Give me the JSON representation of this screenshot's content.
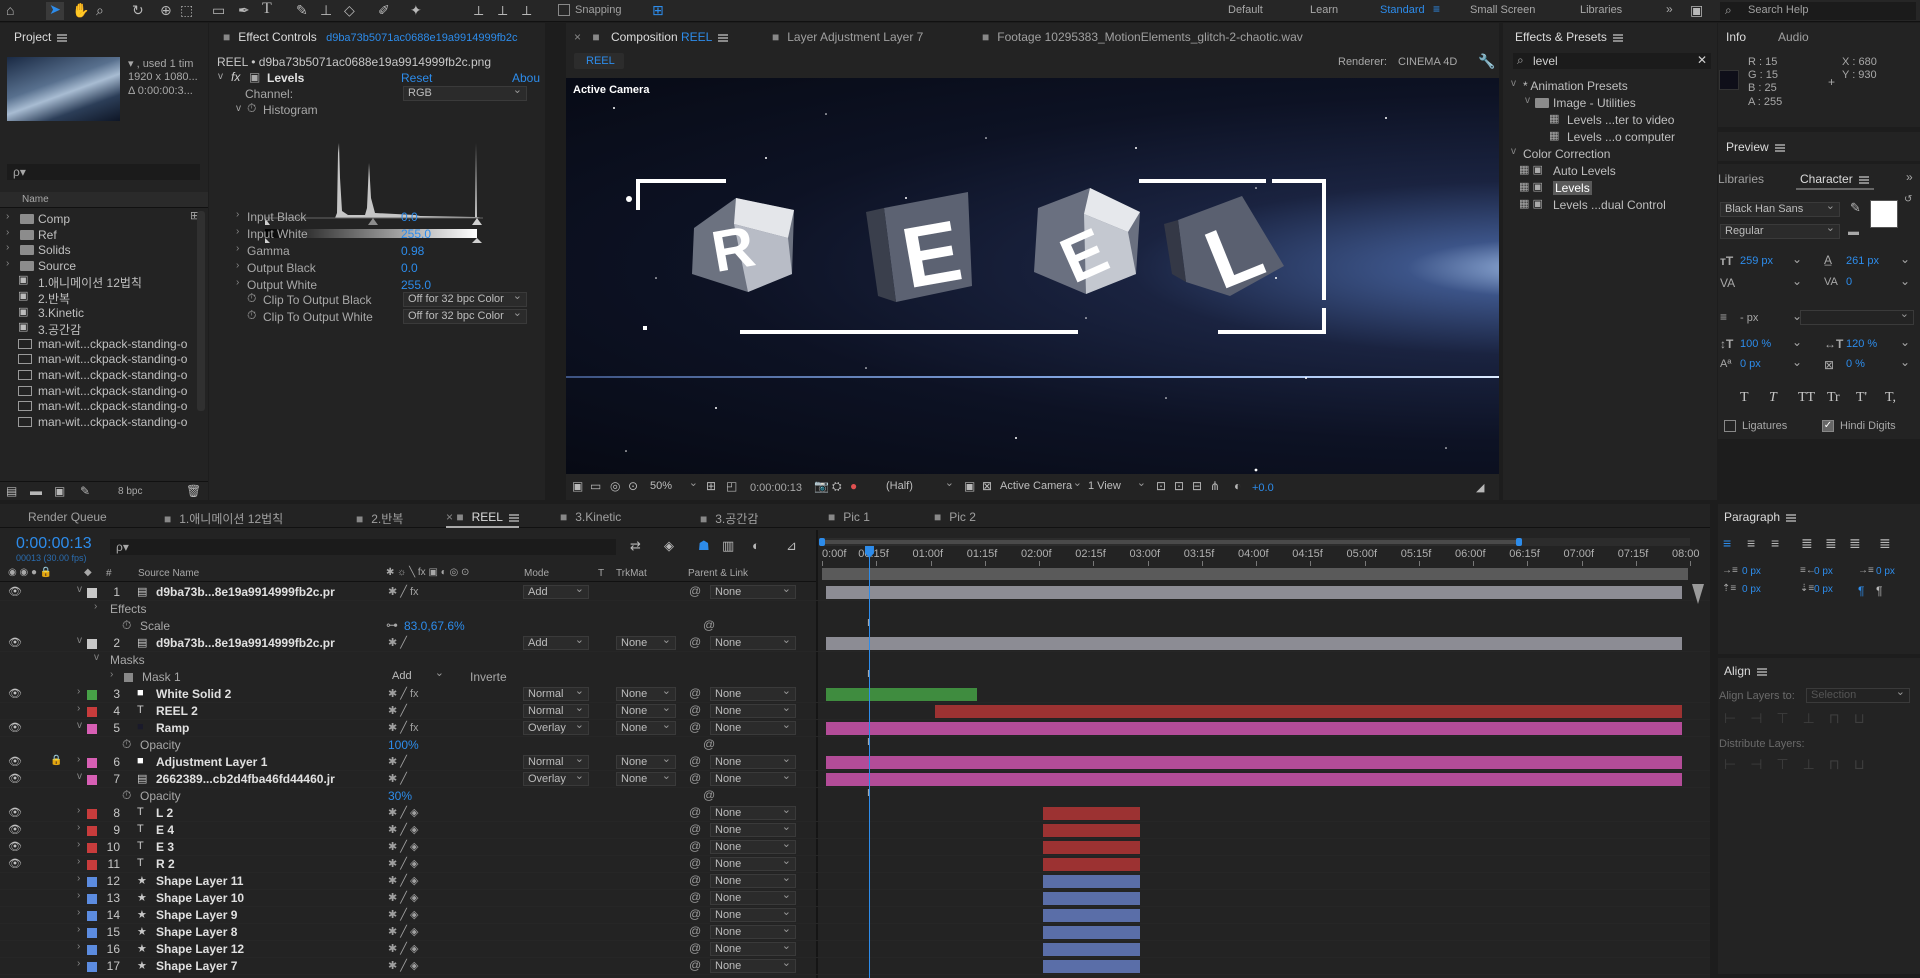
{
  "toolbar": {
    "snapping_label": "Snapping",
    "workspaces": [
      "Default",
      "Learn",
      "Standard",
      "Small Screen",
      "Libraries"
    ],
    "active_workspace": "Standard",
    "search_help": "Search Help"
  },
  "project": {
    "tab": "Project",
    "thumb_info": [
      "▾ , used 1 tim",
      "1920 x 1080...",
      "Δ 0:00:00:3..."
    ],
    "search_placeholder": "ρ▾",
    "col_name": "Name",
    "items": [
      {
        "label": "Comp",
        "type": "folder"
      },
      {
        "label": "Ref",
        "type": "folder"
      },
      {
        "label": "Solids",
        "type": "folder"
      },
      {
        "label": "Source",
        "type": "folder"
      },
      {
        "label": "1.애니메이션 12법칙",
        "type": "comp"
      },
      {
        "label": "2.반복",
        "type": "comp"
      },
      {
        "label": "3.Kinetic",
        "type": "comp"
      },
      {
        "label": "3.공간감",
        "type": "comp"
      },
      {
        "label": "man-wit...ckpack-standing-o",
        "type": "footage"
      },
      {
        "label": "man-wit...ckpack-standing-o",
        "type": "footage"
      },
      {
        "label": "man-wit...ckpack-standing-o",
        "type": "footage"
      },
      {
        "label": "man-wit...ckpack-standing-o",
        "type": "footage"
      },
      {
        "label": "man-wit...ckpack-standing-o",
        "type": "footage"
      },
      {
        "label": "man-wit...ckpack-standing-o",
        "type": "footage"
      }
    ],
    "bpc": "8 bpc"
  },
  "effect_controls": {
    "tab_prefix": "Effect Controls",
    "tab_file": "d9ba73b5071ac0688e19a9914999fb2c",
    "header": "REEL • d9ba73b5071ac0688e19a9914999fb2c.png",
    "effect_name": "Levels",
    "reset": "Reset",
    "about": "Abou",
    "channel_label": "Channel:",
    "channel_value": "RGB",
    "histogram_label": "Histogram",
    "params": [
      {
        "label": "Input Black",
        "value": "0.0"
      },
      {
        "label": "Input White",
        "value": "255.0"
      },
      {
        "label": "Gamma",
        "value": "0.98"
      },
      {
        "label": "Output Black",
        "value": "0.0"
      },
      {
        "label": "Output White",
        "value": "255.0"
      }
    ],
    "clip_black_label": "Clip To Output Black",
    "clip_black_value": "Off for 32 bpc Color",
    "clip_white_label": "Clip To Output White",
    "clip_white_value": "Off for 32 bpc Color"
  },
  "composition": {
    "tabs": [
      {
        "label": "Composition",
        "accent": "REEL"
      },
      {
        "label": "Layer  Adjustment Layer 7"
      },
      {
        "label": "Footage  10295383_MotionElements_glitch-2-chaotic.wav"
      }
    ],
    "subtab": "REEL",
    "renderer_label": "Renderer:",
    "renderer_value": "CINEMA 4D",
    "active_camera": "Active Camera",
    "letters": [
      "R",
      "E",
      "E",
      "L"
    ],
    "footer": {
      "zoom": "50%",
      "timecode": "0:00:00:13",
      "resolution": "(Half)",
      "camera": "Active Camera",
      "views": "1 View",
      "exposure": "+0.0"
    }
  },
  "effects_presets": {
    "tab": "Effects & Presets",
    "search_value": "level",
    "tree": [
      {
        "label": "* Animation Presets",
        "indent": 0,
        "expand": "v"
      },
      {
        "label": "Image - Utilities",
        "indent": 1,
        "expand": "v"
      },
      {
        "label": "Levels ...ter to video",
        "indent": 2
      },
      {
        "label": "Levels ...o computer",
        "indent": 2
      },
      {
        "label": "Color Correction",
        "indent": 0,
        "expand": "v"
      },
      {
        "label": "Auto Levels",
        "indent": 1
      },
      {
        "label": "Levels",
        "indent": 1,
        "selected": true
      },
      {
        "label": "Levels ...dual Control",
        "indent": 1
      }
    ]
  },
  "info": {
    "tabs": [
      "Info",
      "Audio"
    ],
    "R": "R : 15",
    "G": "G : 15",
    "B": "B : 25",
    "A": "A : 255",
    "X": "X : 680",
    "Y": "Y : 930"
  },
  "preview": {
    "tab": "Preview"
  },
  "character": {
    "tabs": [
      "Libraries",
      "Character"
    ],
    "font": "Black Han Sans",
    "style": "Regular",
    "size": "259 px",
    "leading": "261 px",
    "kerning_label": "VA",
    "tracking": "0",
    "stroke": "- px",
    "vscale": "100 %",
    "hscale": "120 %",
    "baseline": "0 px",
    "tsume": "0 %",
    "styles": [
      "T",
      "T",
      "TT",
      "Tr",
      "T'",
      "T,"
    ],
    "ligatures": "Ligatures",
    "hindi": "Hindi Digits"
  },
  "paragraph": {
    "tab": "Paragraph",
    "indent_values": [
      "0 px",
      "0 px",
      "0 px",
      "0 px",
      "0 px"
    ]
  },
  "align": {
    "tab": "Align",
    "align_to_label": "Align Layers to:",
    "align_to_value": "Selection",
    "distribute_label": "Distribute Layers:"
  },
  "timeline": {
    "tabs": [
      "Render Queue",
      "1.애니메이션 12법칙",
      "2.반복",
      "REEL",
      "3.Kinetic",
      "3.공간감",
      "Pic 1",
      "Pic 2"
    ],
    "active_tab": "REEL",
    "timecode": "0:00:00:13",
    "timecode_sub": "00013 (30.00 fps)",
    "search_placeholder": "ρ▾",
    "columns": {
      "source": "Source Name",
      "mode": "Mode",
      "t": "T",
      "trkmat": "TrkMat",
      "parent": "Parent & Link"
    },
    "ruler": [
      "0:00f",
      "00:15f",
      "01:00f",
      "01:15f",
      "02:00f",
      "02:15f",
      "03:00f",
      "03:15f",
      "04:00f",
      "04:15f",
      "05:00f",
      "05:15f",
      "06:00f",
      "06:15f",
      "07:00f",
      "07:15f",
      "08:00"
    ],
    "playhead_seconds": 0.433,
    "duration_seconds": 8,
    "work_area_seconds": [
      0,
      6.5
    ],
    "rows": [
      {
        "kind": "layer",
        "num": "1",
        "type": "img",
        "name": "d9ba73b...8e19a9914999fb2c.pr",
        "color": "#c8c8c8",
        "mode": "Add",
        "trk": "",
        "parent": "None",
        "fx": true,
        "bar": [
          0,
          8
        ],
        "barColor": "#8c8c94",
        "eye": true
      },
      {
        "kind": "sub",
        "label": "Effects",
        "indent": 1
      },
      {
        "kind": "prop",
        "label": "Scale",
        "value": "83.0,67.6%",
        "link": true
      },
      {
        "kind": "layer",
        "num": "2",
        "type": "img",
        "name": "d9ba73b...8e19a9914999fb2c.pr",
        "color": "#c8c8c8",
        "mode": "Add",
        "trk": "None",
        "parent": "None",
        "fx": false,
        "bar": [
          0,
          8
        ],
        "barColor": "#8c8c94",
        "eye": true
      },
      {
        "kind": "sub",
        "label": "Masks",
        "indent": 1
      },
      {
        "kind": "mask",
        "label": "Mask 1",
        "mode": "Add",
        "inv": "Inverte"
      },
      {
        "kind": "layer",
        "num": "3",
        "type": "solid",
        "name": "White Solid 2",
        "color": "#47a147",
        "mode": "Normal",
        "trk": "None",
        "parent": "None",
        "fx": true,
        "bar": [
          0,
          1.5
        ],
        "barColor": "#3f8c3f",
        "eye": true
      },
      {
        "kind": "layer",
        "num": "4",
        "type": "T",
        "name": "REEL 2",
        "color": "#c83c3c",
        "mode": "Normal",
        "trk": "None",
        "parent": "None",
        "fx": false,
        "bar": [
          1.0,
          8
        ],
        "barColor": "#9c3232",
        "eye": false
      },
      {
        "kind": "layer",
        "num": "5",
        "type": "solid",
        "name": "Ramp",
        "color": "#d75fb4",
        "mode": "Overlay",
        "trk": "None",
        "parent": "None",
        "fx": true,
        "bar": [
          0,
          8
        ],
        "barColor": "#b34c98",
        "eye": true
      },
      {
        "kind": "prop",
        "label": "Opacity",
        "value": "100%"
      },
      {
        "kind": "layer",
        "num": "6",
        "type": "solid",
        "name": "Adjustment Layer 1",
        "color": "#d75fb4",
        "mode": "Normal",
        "trk": "None",
        "parent": "None",
        "fx": false,
        "bar": [
          0,
          8
        ],
        "barColor": "#b34c98",
        "eye": true,
        "lock": true
      },
      {
        "kind": "layer",
        "num": "7",
        "type": "img",
        "name": "2662389...cb2d4fba46fd44460.jr",
        "color": "#d75fb4",
        "mode": "Overlay",
        "trk": "None",
        "parent": "None",
        "fx": false,
        "bar": [
          0,
          8
        ],
        "barColor": "#b34c98",
        "eye": true
      },
      {
        "kind": "prop",
        "label": "Opacity",
        "value": "30%"
      },
      {
        "kind": "layer",
        "num": "8",
        "type": "T",
        "name": "L 2",
        "color": "#c83c3c",
        "mode": "",
        "trk": "",
        "parent": "None",
        "bar": [
          2.0,
          3.0
        ],
        "barColor": "#9c3232",
        "eye": true,
        "cube": true
      },
      {
        "kind": "layer",
        "num": "9",
        "type": "T",
        "name": "E 4",
        "color": "#c83c3c",
        "mode": "",
        "trk": "",
        "parent": "None",
        "bar": [
          2.0,
          3.0
        ],
        "barColor": "#9c3232",
        "eye": true,
        "cube": true
      },
      {
        "kind": "layer",
        "num": "10",
        "type": "T",
        "name": "E 3",
        "color": "#c83c3c",
        "mode": "",
        "trk": "",
        "parent": "None",
        "bar": [
          2.0,
          3.0
        ],
        "barColor": "#9c3232",
        "eye": true,
        "cube": true
      },
      {
        "kind": "layer",
        "num": "11",
        "type": "T",
        "name": "R 2",
        "color": "#c83c3c",
        "mode": "",
        "trk": "",
        "parent": "None",
        "bar": [
          2.0,
          3.0
        ],
        "barColor": "#9c3232",
        "eye": true,
        "cube": true
      },
      {
        "kind": "layer",
        "num": "12",
        "type": "star",
        "name": "Shape Layer 11",
        "color": "#5c8ce0",
        "mode": "",
        "trk": "",
        "parent": "None",
        "bar": [
          2.0,
          3.0
        ],
        "barColor": "#5a6ea8",
        "eye": false,
        "cube": true
      },
      {
        "kind": "layer",
        "num": "13",
        "type": "star",
        "name": "Shape Layer 10",
        "color": "#5c8ce0",
        "mode": "",
        "trk": "",
        "parent": "None",
        "bar": [
          2.0,
          3.0
        ],
        "barColor": "#5a6ea8",
        "eye": false,
        "cube": true
      },
      {
        "kind": "layer",
        "num": "14",
        "type": "star",
        "name": "Shape Layer 9",
        "color": "#5c8ce0",
        "mode": "",
        "trk": "",
        "parent": "None",
        "bar": [
          2.0,
          3.0
        ],
        "barColor": "#5a6ea8",
        "eye": false,
        "cube": true
      },
      {
        "kind": "layer",
        "num": "15",
        "type": "star",
        "name": "Shape Layer 8",
        "color": "#5c8ce0",
        "mode": "",
        "trk": "",
        "parent": "None",
        "bar": [
          2.0,
          3.0
        ],
        "barColor": "#5a6ea8",
        "eye": false,
        "cube": true
      },
      {
        "kind": "layer",
        "num": "16",
        "type": "star",
        "name": "Shape Layer 12",
        "color": "#5c8ce0",
        "mode": "",
        "trk": "",
        "parent": "None",
        "bar": [
          2.0,
          3.0
        ],
        "barColor": "#5a6ea8",
        "eye": false,
        "cube": true
      },
      {
        "kind": "layer",
        "num": "17",
        "type": "star",
        "name": "Shape Layer 7",
        "color": "#5c8ce0",
        "mode": "",
        "trk": "",
        "parent": "None",
        "bar": [
          2.0,
          3.0
        ],
        "barColor": "#5a6ea8",
        "eye": false,
        "cube": true
      }
    ]
  }
}
